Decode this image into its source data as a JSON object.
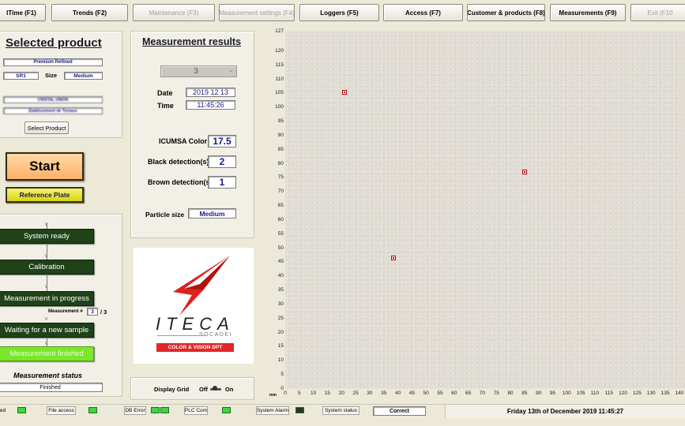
{
  "fbar": [
    {
      "label": "lTime (F1)",
      "disabled": false
    },
    {
      "label": "Trends (F2)",
      "disabled": false
    },
    {
      "label": "Maintenance (F3)",
      "disabled": true
    },
    {
      "label": "Measurement settings (F4)",
      "disabled": true
    },
    {
      "label": "Loggers (F5)",
      "disabled": false
    },
    {
      "label": "Access (F7)",
      "disabled": false
    },
    {
      "label": "Customer & products (F8)",
      "disabled": false
    },
    {
      "label": "Measurements (F9)",
      "disabled": false
    },
    {
      "label": "Exit (F10",
      "disabled": true
    }
  ],
  "product": {
    "title": "Selected product",
    "name": "Premium Refined",
    "code": "SR1",
    "size_label": "Size",
    "size": "Medium",
    "customer_line1": "CRISTAL UNION",
    "customer_line2": "Établissement de Toreaux",
    "select_label": "Select Product"
  },
  "actions": {
    "start_label": "Start",
    "reference_label": "Reference Plate"
  },
  "process": {
    "steps": [
      "System ready",
      "Calibration",
      "Measurement in progress",
      "Waiting for a new sample",
      "Measurement finished"
    ],
    "meas_label": "Measurement #",
    "meas_current": "3",
    "meas_total": "/ 3",
    "status_title": "Measurement status",
    "status_value": "Finished"
  },
  "results": {
    "title": "Measurement results",
    "selector": "3",
    "date_label": "Date",
    "date": "2019 12 13",
    "time_label": "Time",
    "time": "11:45:26",
    "icumsa_label": "ICUMSA Color",
    "icumsa": "17.5",
    "black_label": "Black detection(s)",
    "black": "2",
    "brown_label": "Brown detection(s)",
    "brown": "1",
    "particle_label": "Particle size",
    "particle": "Medium"
  },
  "logo": {
    "brand": "ITECA",
    "sub": "SOCADEI",
    "tagline": "COLOR & VISION DPT"
  },
  "grid": {
    "label": "Display Grid",
    "off": "Off",
    "on": "On"
  },
  "chart": {
    "unit": "mm",
    "ymax": 127,
    "xmax": 142,
    "yticks": [
      "127",
      "120",
      "115",
      "110",
      "105",
      "100",
      "95",
      "90",
      "85",
      "80",
      "75",
      "70",
      "65",
      "60",
      "55",
      "50",
      "45",
      "40",
      "35",
      "30",
      "25",
      "20",
      "15",
      "10",
      "5",
      "0"
    ],
    "xticks": [
      "0",
      "5",
      "10",
      "15",
      "20",
      "25",
      "30",
      "35",
      "40",
      "45",
      "50",
      "55",
      "60",
      "65",
      "70",
      "75",
      "80",
      "85",
      "90",
      "95",
      "100",
      "105",
      "110",
      "115",
      "120",
      "125",
      "130",
      "135",
      "140"
    ],
    "points": [
      {
        "x": 21,
        "y": 105.5
      },
      {
        "x": 38.5,
        "y": 46.5
      },
      {
        "x": 85,
        "y": 77
      }
    ]
  },
  "status": {
    "labels": [
      "ed",
      "File access",
      "DB Error",
      "PLC Com",
      "System Alarm",
      "System status"
    ],
    "system_value": "Correct",
    "datetime": "Friday 13th of December 2019  11:45:27"
  }
}
